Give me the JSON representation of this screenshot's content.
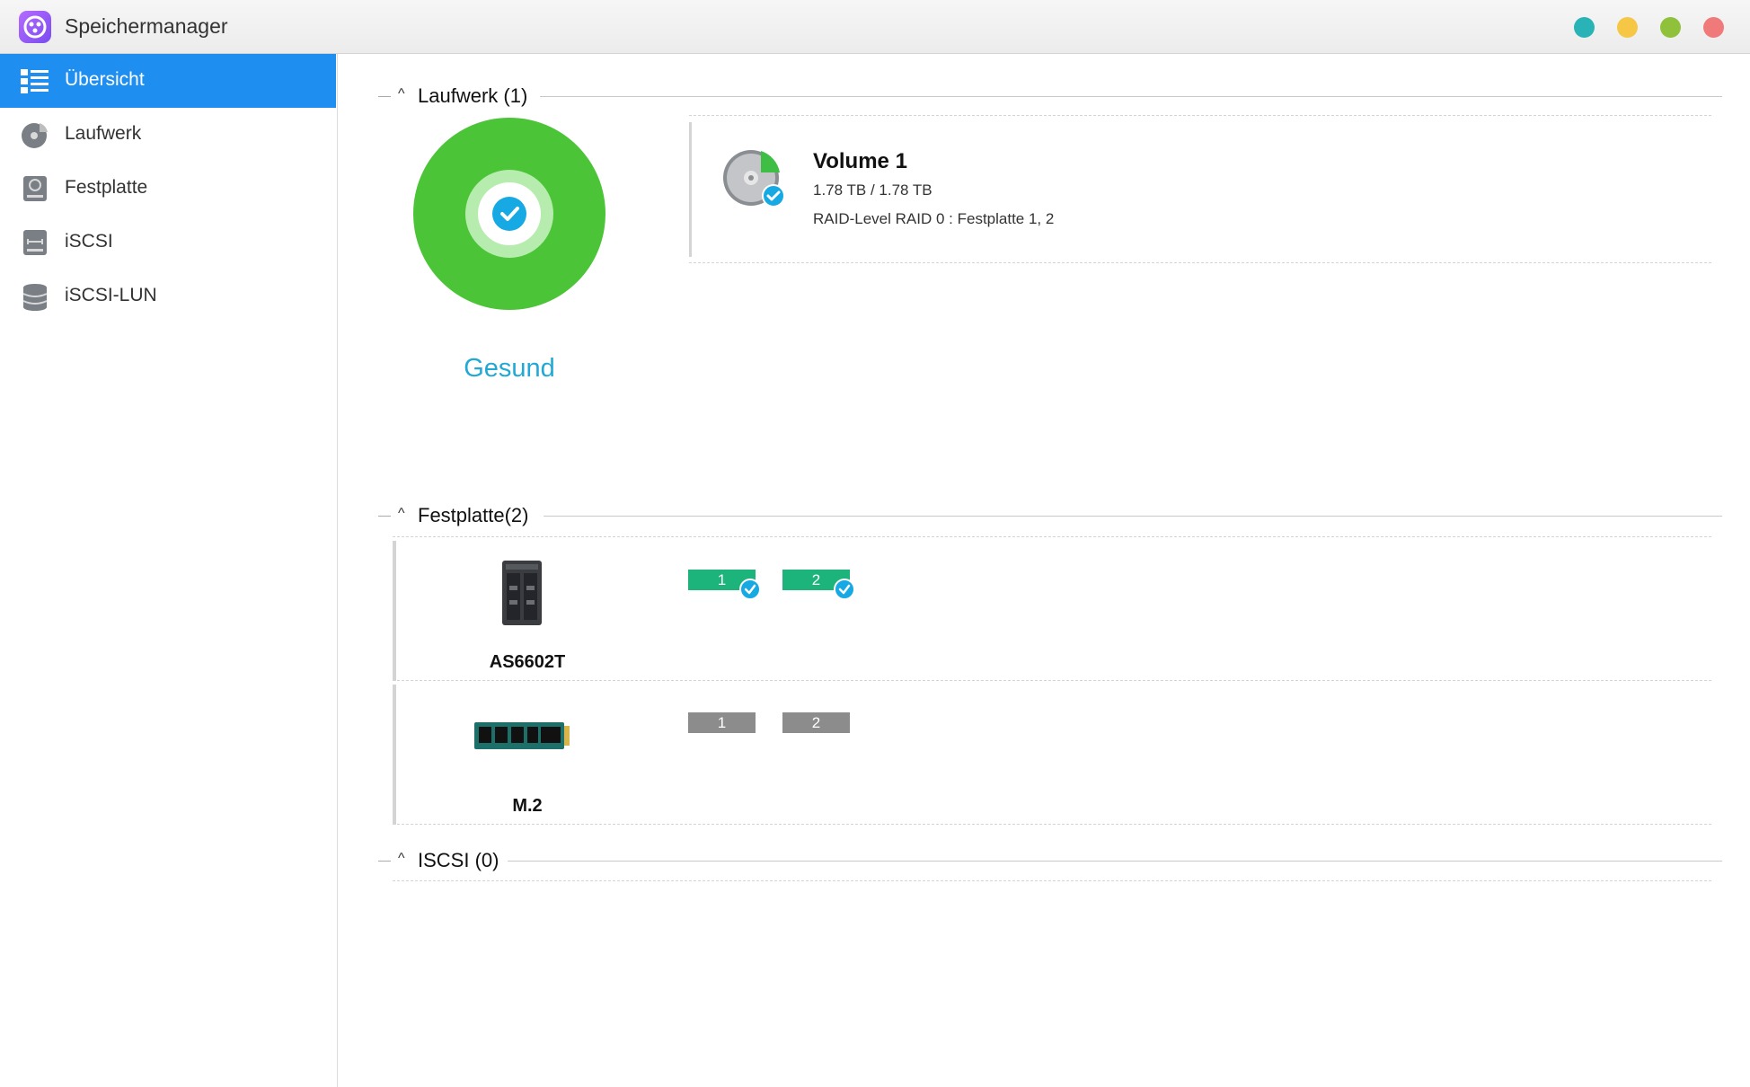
{
  "window": {
    "title": "Speichermanager",
    "buttons": [
      "teal",
      "yellow",
      "green",
      "red"
    ]
  },
  "sidebar": {
    "items": [
      {
        "label": "Übersicht",
        "icon": "list-icon",
        "active": true
      },
      {
        "label": "Laufwerk",
        "icon": "volume-icon",
        "active": false
      },
      {
        "label": "Festplatte",
        "icon": "hard-disk-icon",
        "active": false
      },
      {
        "label": "iSCSI",
        "icon": "iscsi-icon",
        "active": false
      },
      {
        "label": "iSCSI-LUN",
        "icon": "database-icon",
        "active": false
      }
    ]
  },
  "main": {
    "volumes_section": {
      "title": "Laufwerk (1)",
      "status": "Gesund",
      "volume": {
        "name": "Volume 1",
        "size": "1.78 TB / 1.78 TB",
        "raid": "RAID-Level RAID 0 : Festplatte 1, 2"
      }
    },
    "disks_section": {
      "title": "Festplatte(2)",
      "devices": [
        {
          "name": "AS6602T",
          "slots": [
            {
              "label": "1",
              "state": "ok"
            },
            {
              "label": "2",
              "state": "ok"
            }
          ]
        },
        {
          "name": "M.2",
          "slots": [
            {
              "label": "1",
              "state": "empty"
            },
            {
              "label": "2",
              "state": "empty"
            }
          ]
        }
      ]
    },
    "iscsi_section": {
      "title": "ISCSI (0)"
    }
  },
  "colors": {
    "accent": "#1e8ff1",
    "healthy": "#4cc437",
    "status_text": "#21a8d4",
    "disk_ok": "#1db47c",
    "disk_empty": "#8c8c8c"
  }
}
